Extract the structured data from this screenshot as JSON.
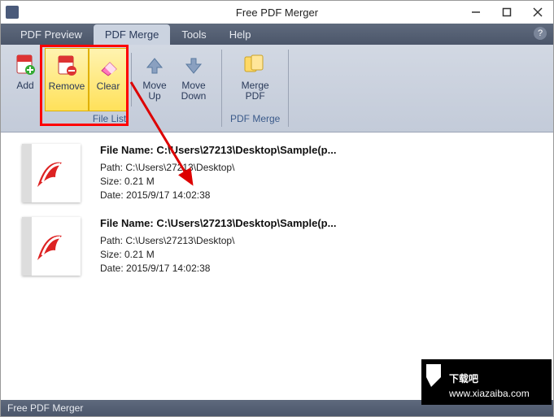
{
  "window": {
    "title": "Free PDF Merger"
  },
  "tabs": {
    "preview": "PDF Preview",
    "merge": "PDF Merge",
    "tools": "Tools",
    "help": "Help"
  },
  "ribbon": {
    "add": "Add",
    "remove": "Remove",
    "clear": "Clear",
    "moveup": "Move\nUp",
    "movedown": "Move\nDown",
    "merge": "Merge\nPDF",
    "group_filelist": "File List",
    "group_pdfmerge": "PDF Merge"
  },
  "files": [
    {
      "filename": "File Name:  C:\\Users\\27213\\Desktop\\Sample(p...",
      "path": "Path:  C:\\Users\\27213\\Desktop\\",
      "size": "Size:  0.21 M",
      "date": "Date:  2015/9/17 14:02:38"
    },
    {
      "filename": "File Name:  C:\\Users\\27213\\Desktop\\Sample(p...",
      "path": "Path:  C:\\Users\\27213\\Desktop\\",
      "size": "Size:  0.21 M",
      "date": "Date:  2015/9/17 14:02:38"
    }
  ],
  "status": "Free PDF Merger",
  "watermark": {
    "line1": "下载吧",
    "line2": "www.xiazaiba.com"
  }
}
